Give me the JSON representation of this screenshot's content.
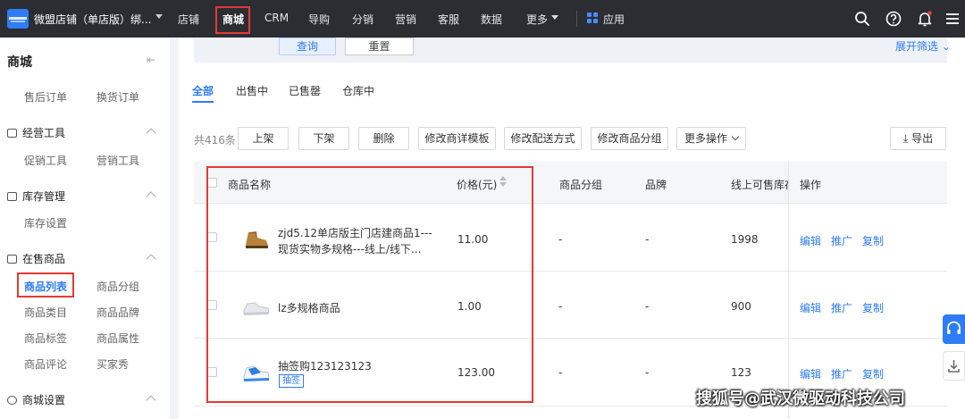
{
  "topbar": {
    "store_name": "微盟店铺（单店版）绑...",
    "nav": [
      "店铺",
      "商城",
      "CRM",
      "导购",
      "分销",
      "营销",
      "客服",
      "数据",
      "更多"
    ],
    "active_nav": "商城",
    "apps_label": "应用",
    "notification_dot_color": "#e53935"
  },
  "sidebar": {
    "title": "商城",
    "top_links": [
      "售后订单",
      "换货订单"
    ],
    "sections": [
      {
        "title": "经营工具",
        "icon": "tools-icon",
        "links": [
          "促销工具",
          "营销工具"
        ]
      },
      {
        "title": "库存管理",
        "icon": "inventory-icon",
        "links": [
          "库存设置"
        ]
      },
      {
        "title": "在售商品",
        "icon": "goods-icon",
        "links": [
          "商品列表",
          "商品分组",
          "商品类目",
          "商品品牌",
          "商品标签",
          "商品属性",
          "商品评论",
          "买家秀"
        ]
      },
      {
        "title": "商城设置",
        "icon": "settings-icon",
        "links": []
      }
    ],
    "active_link": "商品列表"
  },
  "filter": {
    "query_label": "查询",
    "reset_label": "重置",
    "expand_label": "展开筛选"
  },
  "tabs": [
    "全部",
    "出售中",
    "已售罄",
    "仓库中"
  ],
  "active_tab": "全部",
  "toolbar": {
    "count_label": "共416条",
    "buttons": [
      "上架",
      "下架",
      "删除",
      "修改商详模板",
      "修改配送方式",
      "修改商品分组",
      "更多操作"
    ],
    "export_label": "导出"
  },
  "table": {
    "headers": [
      "商品名称",
      "价格(元)",
      "商品分组",
      "品牌",
      "线上可售库存",
      "操作"
    ],
    "rows": [
      {
        "name_line1": "zjd5.12单店版主门店建商品1---",
        "name_line2": "现货实物多规格---线上/线下...",
        "price": "11.00",
        "group": "-",
        "brand": "-",
        "stock": "1998",
        "tag": "",
        "thumb": "brown-boot"
      },
      {
        "name_line1": "lz多规格商品",
        "name_line2": "",
        "price": "1.00",
        "group": "-",
        "brand": "-",
        "stock": "900",
        "tag": "",
        "thumb": "white-sneaker"
      },
      {
        "name_line1": "抽签购123123123",
        "name_line2": "",
        "price": "123.00",
        "group": "-",
        "brand": "-",
        "stock": "123",
        "tag": "抽签",
        "thumb": "blue-sneaker"
      }
    ],
    "actions": [
      "编辑",
      "推广",
      "复制"
    ]
  },
  "watermark": "搜狐号@武汉微驱动科技公司",
  "colors": {
    "accent": "#2e7cf6",
    "highlight_border": "#e53935",
    "topbar": "#2b2d33"
  }
}
